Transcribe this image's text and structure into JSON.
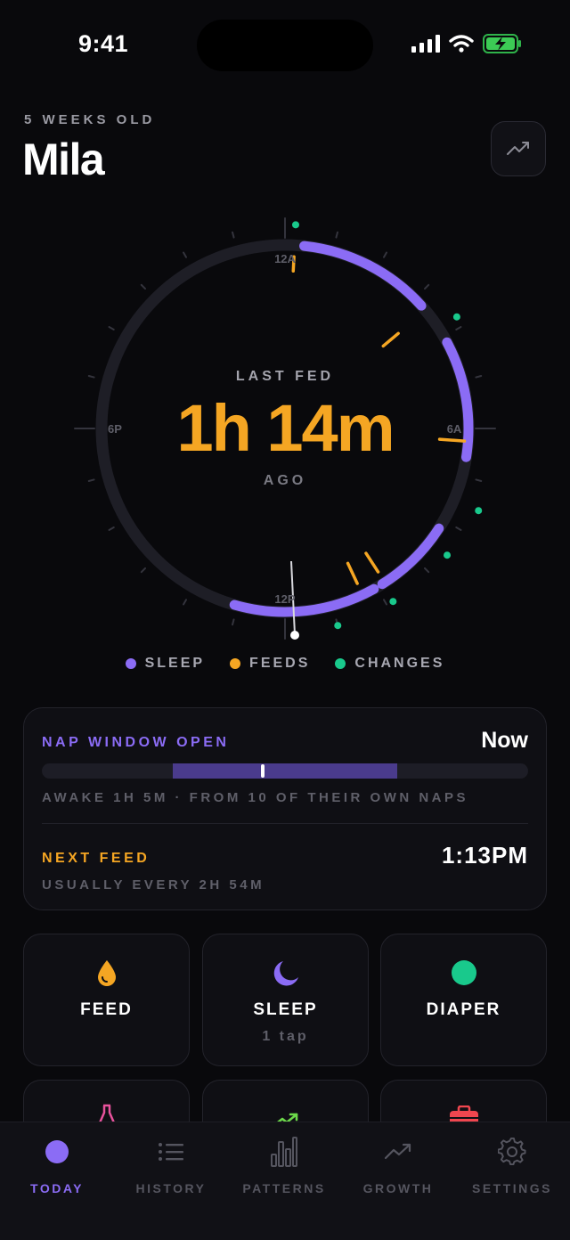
{
  "status_bar": {
    "time": "9:41"
  },
  "header": {
    "age": "5 WEEKS OLD",
    "name": "Mila",
    "trend_button_icon": "trend-up-icon"
  },
  "clock": {
    "center_label": "LAST FED",
    "elapsed": "1h 14m",
    "sub_label": "AGO",
    "hour_labels": {
      "top": "12A",
      "right": "6A",
      "bottom": "12P",
      "left": "6P"
    }
  },
  "legend": [
    {
      "label": "SLEEP",
      "color": "#8b6cf5"
    },
    {
      "label": "FEEDS",
      "color": "#f5a623"
    },
    {
      "label": "CHANGES",
      "color": "#19c98c"
    }
  ],
  "nap": {
    "label": "NAP WINDOW OPEN",
    "status": "Now",
    "detail": "AWAKE 1H 5M · FROM 10 OF THEIR OWN NAPS",
    "window_start": 0.27,
    "window_end": 0.73,
    "current": 0.455
  },
  "next_feed": {
    "label": "NEXT FEED",
    "time": "1:13PM",
    "detail": "USUALLY EVERY 2H 54M"
  },
  "actions": [
    {
      "label": "FEED",
      "icon": "drop-icon",
      "sub": ""
    },
    {
      "label": "SLEEP",
      "icon": "moon-icon",
      "sub": "1 tap"
    },
    {
      "label": "DIAPER",
      "icon": "circle-icon",
      "sub": ""
    }
  ],
  "partial_actions": [
    {
      "icon": "bottle-icon"
    },
    {
      "icon": "growth-chart-icon"
    },
    {
      "icon": "medkit-icon"
    }
  ],
  "tabs": [
    {
      "label": "TODAY",
      "icon": "today-dot-icon",
      "active": true
    },
    {
      "label": "HISTORY",
      "icon": "list-icon",
      "active": false
    },
    {
      "label": "PATTERNS",
      "icon": "bar-chart-icon",
      "active": false
    },
    {
      "label": "GROWTH",
      "icon": "trend-up-icon",
      "active": false
    },
    {
      "label": "SETTINGS",
      "icon": "gear-icon",
      "active": false
    }
  ],
  "colors": {
    "accent": "#8b6cf5",
    "feed": "#f5a623",
    "change": "#19c98c",
    "background": "#09090c"
  }
}
